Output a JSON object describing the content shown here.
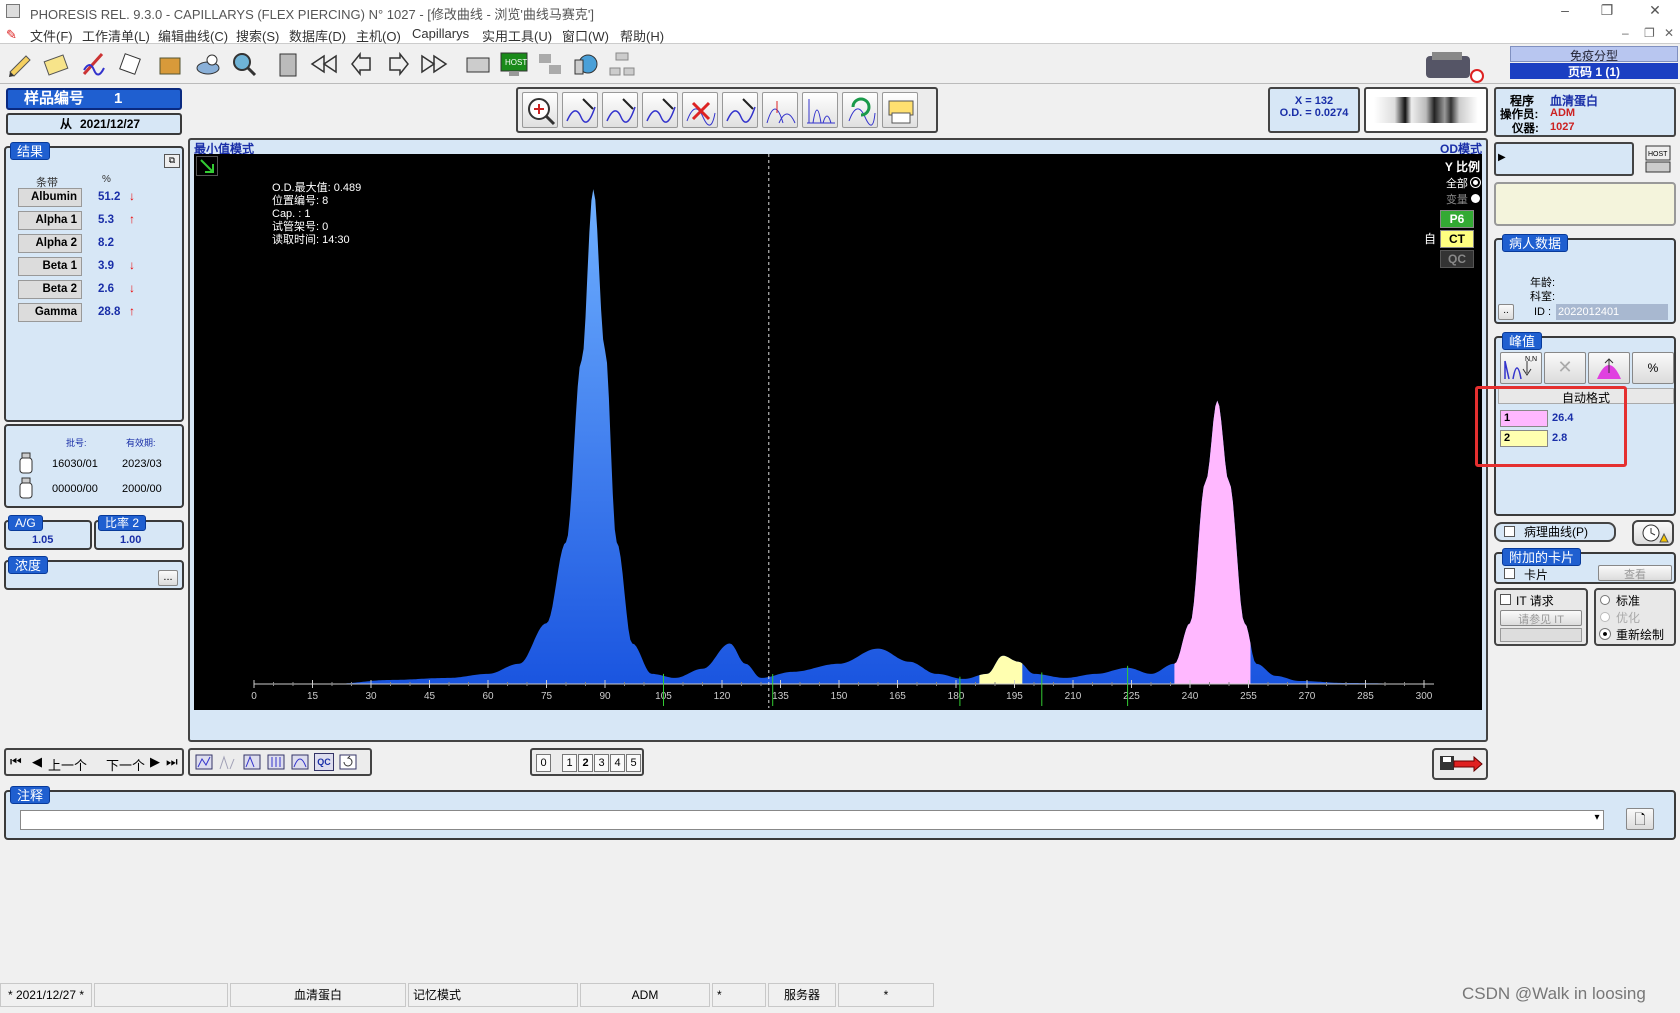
{
  "window": {
    "title": "PHORESIS REL. 9.3.0 - CAPILLARYS (FLEX PIERCING) N° 1027 - [修改曲线 - 浏览'曲线马赛克']",
    "controls": [
      "–",
      "❐",
      "✕"
    ]
  },
  "menu": [
    "文件(F)",
    "工作清单(L)",
    "编辑曲线(C)",
    "搜索(S)",
    "数据库(D)",
    "主机(O)",
    "Capillarys",
    "实用工具(U)",
    "窗口(W)",
    "帮助(H)"
  ],
  "top_right": {
    "mode": "免疫分型",
    "page": "页码 1 (1)"
  },
  "sample": {
    "label": "样品编号",
    "number": "1",
    "from_label": "从",
    "date": "2021/12/27"
  },
  "results": {
    "title": "结果",
    "col_fraction": "条带",
    "col_percent": "%",
    "rows": [
      {
        "name": "Albumin",
        "value": "51.2",
        "flag": "↓"
      },
      {
        "name": "Alpha 1",
        "value": "5.3",
        "flag": "↑"
      },
      {
        "name": "Alpha 2",
        "value": "8.2",
        "flag": ""
      },
      {
        "name": "Beta 1",
        "value": "3.9",
        "flag": "↓"
      },
      {
        "name": "Beta 2",
        "value": "2.6",
        "flag": "↓"
      },
      {
        "name": "Gamma",
        "value": "28.8",
        "flag": "↑"
      }
    ]
  },
  "lots": {
    "lot_label": "批号:",
    "exp_label": "有效期:",
    "rows": [
      {
        "lot": "16030/01",
        "exp": "2023/03"
      },
      {
        "lot": "00000/00",
        "exp": "2000/00"
      }
    ]
  },
  "ag": {
    "label": "A/G",
    "value": "1.05"
  },
  "ratio": {
    "label": "比率 2",
    "value": "1.00"
  },
  "concentration": {
    "label": "浓度",
    "button": "..."
  },
  "chart_toolbar": {
    "coord_x": "X = 132",
    "coord_od": "O.D. = 0.0274"
  },
  "chart_area": {
    "mode_left": "最小值模式",
    "mode_right": "OD模式",
    "info_lines": [
      "O.D.最大值: 0.489",
      "位置编号: 8",
      "Cap. : 1",
      "试管架号: 0",
      "读取时间: 14:30"
    ],
    "yscale": {
      "title": "Y 比例",
      "opt_all": "全部",
      "opt_var": "变量",
      "auto": "自",
      "tags": [
        "P6",
        "CT",
        "QC"
      ]
    }
  },
  "chart_data": {
    "type": "area",
    "x_ticks": [
      0,
      15,
      30,
      45,
      60,
      75,
      90,
      105,
      120,
      135,
      150,
      165,
      180,
      195,
      210,
      225,
      240,
      255,
      270,
      285,
      300
    ],
    "xlim": [
      0,
      300
    ],
    "ylim": [
      0,
      0.5
    ],
    "cursor_x": 132,
    "peak_max_od": 0.489,
    "curve": [
      [
        0,
        0.0
      ],
      [
        20,
        0.0
      ],
      [
        35,
        0.004
      ],
      [
        50,
        0.006
      ],
      [
        60,
        0.01
      ],
      [
        68,
        0.02
      ],
      [
        75,
        0.06
      ],
      [
        80,
        0.14
      ],
      [
        84,
        0.32
      ],
      [
        87,
        0.489
      ],
      [
        90,
        0.33
      ],
      [
        93,
        0.14
      ],
      [
        97,
        0.04
      ],
      [
        102,
        0.01
      ],
      [
        108,
        0.006
      ],
      [
        115,
        0.015
      ],
      [
        122,
        0.04
      ],
      [
        126,
        0.02
      ],
      [
        130,
        0.006
      ],
      [
        138,
        0.012
      ],
      [
        150,
        0.02
      ],
      [
        160,
        0.035
      ],
      [
        168,
        0.022
      ],
      [
        175,
        0.01
      ],
      [
        182,
        0.005
      ],
      [
        188,
        0.01
      ],
      [
        192,
        0.028
      ],
      [
        196,
        0.022
      ],
      [
        200,
        0.01
      ],
      [
        208,
        0.006
      ],
      [
        216,
        0.01
      ],
      [
        224,
        0.016
      ],
      [
        230,
        0.01
      ],
      [
        236,
        0.02
      ],
      [
        240,
        0.06
      ],
      [
        244,
        0.2
      ],
      [
        247,
        0.28
      ],
      [
        250,
        0.2
      ],
      [
        254,
        0.06
      ],
      [
        257,
        0.02
      ],
      [
        262,
        0.008
      ],
      [
        268,
        0.003
      ],
      [
        280,
        0.001
      ],
      [
        300,
        0.0
      ]
    ]
  },
  "program": {
    "prog_label": "程序",
    "prog_value": "血清蛋白",
    "op_label": "操作员:",
    "op_value": "ADM",
    "inst_label": "仪器:",
    "inst_value": "1027"
  },
  "patient": {
    "title": "病人数据",
    "age_label": "年龄:",
    "dept_label": "科室:",
    "id_label": "ID :",
    "id_value": "2022012401"
  },
  "peaks": {
    "title": "峰值",
    "header": "自动格式",
    "pct_label": "%",
    "rows": [
      {
        "idx": "1",
        "value": "26.4",
        "color": "#ffb8ff"
      },
      {
        "idx": "2",
        "value": "2.8",
        "color": "#ffffb0"
      }
    ]
  },
  "pathology": {
    "label": "病理曲线(P)"
  },
  "extra_cards": {
    "title": "附加的卡片",
    "card_label": "卡片",
    "view_label": "查看"
  },
  "it_request": {
    "label": "IT 请求",
    "see_label": "请参见 IT"
  },
  "draw_modes": {
    "standard": "标准",
    "optimize": "优化",
    "redraw": "重新绘制"
  },
  "nav": {
    "prev": "上一个",
    "next": "下一个",
    "pages": [
      "0",
      "1",
      "2",
      "3",
      "4",
      "5"
    ],
    "qc": "QC"
  },
  "notes": {
    "title": "注释",
    "value": ""
  },
  "status": {
    "date": "* 2021/12/27 *",
    "program": "血清蛋白",
    "mode": "记忆模式",
    "user": "ADM",
    "star1": "*",
    "server": "服务器",
    "star2": "*"
  },
  "watermark": "CSDN @Walk in loosing"
}
